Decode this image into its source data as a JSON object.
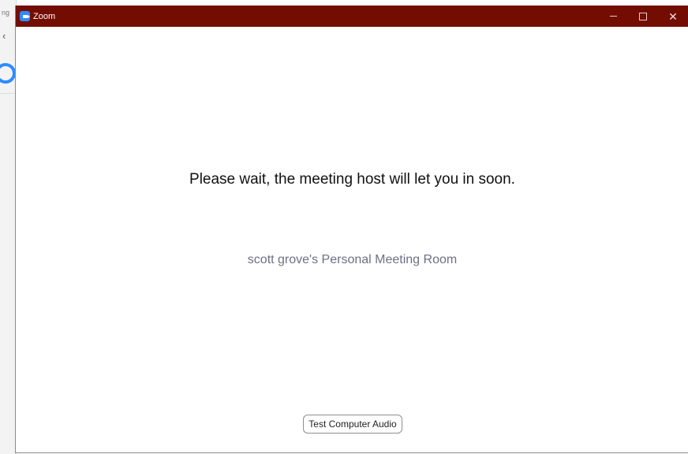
{
  "background_window": {
    "tab_text": "ng",
    "back_glyph": "‹"
  },
  "window": {
    "title": "Zoom",
    "titlebar_color": "#740d01",
    "icon": "zoom-camera-icon",
    "controls": {
      "minimize": "minimize-icon",
      "maximize": "maximize-icon",
      "close": "✕"
    }
  },
  "waiting_room": {
    "message": "Please wait, the meeting host will let you in soon.",
    "room_name": "scott grove's Personal Meeting Room",
    "test_audio_label": "Test Computer Audio"
  }
}
